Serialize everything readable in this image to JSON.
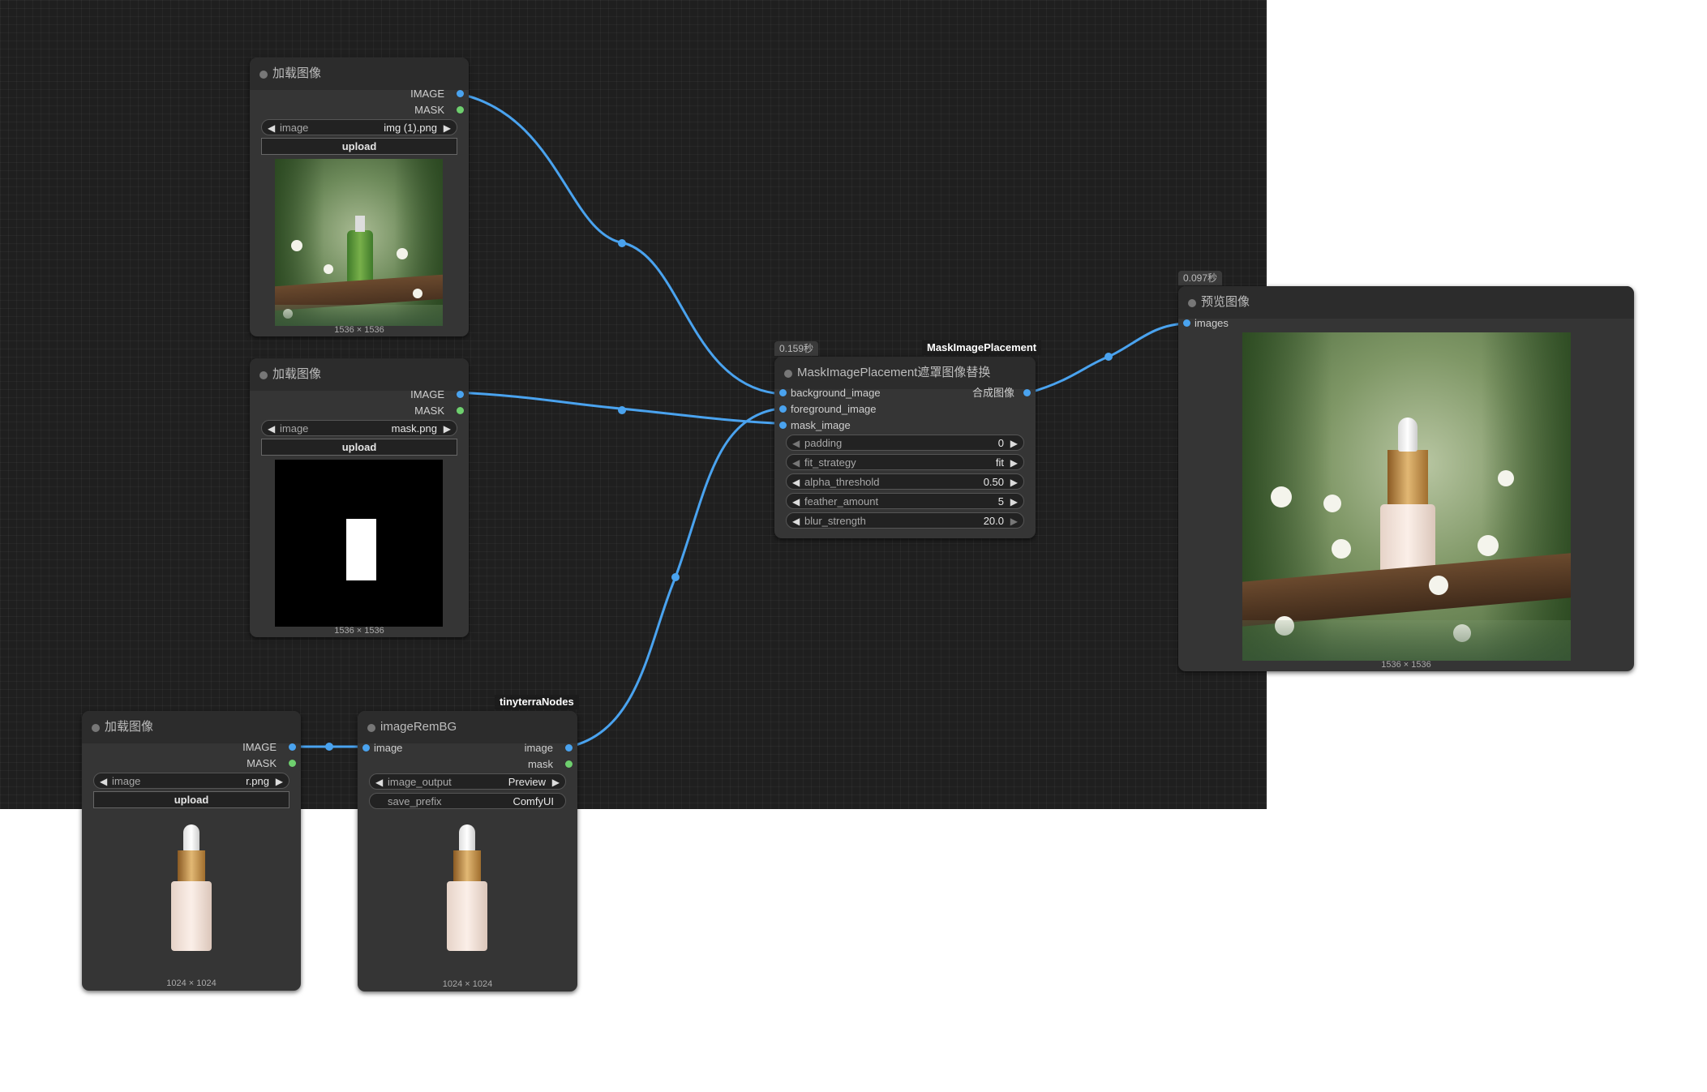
{
  "nodes": {
    "load1": {
      "title": "加载图像",
      "out_image": "IMAGE",
      "out_mask": "MASK",
      "widget_label": "image",
      "widget_value": "img (1).png",
      "upload": "upload",
      "size": "1536 × 1536"
    },
    "load2": {
      "title": "加载图像",
      "out_image": "IMAGE",
      "out_mask": "MASK",
      "widget_label": "image",
      "widget_value": "mask.png",
      "upload": "upload",
      "size": "1536 × 1536"
    },
    "load3": {
      "title": "加载图像",
      "out_image": "IMAGE",
      "out_mask": "MASK",
      "widget_label": "image",
      "widget_value": "r.png",
      "upload": "upload",
      "size": "1024 × 1024"
    },
    "rembg": {
      "tag": "tinyterraNodes",
      "title": "imageRemBG",
      "in_image": "image",
      "out_image": "image",
      "out_mask": "mask",
      "w1_label": "image_output",
      "w1_value": "Preview",
      "w2_label": "save_prefix",
      "w2_value": "ComfyUI",
      "size": "1024 × 1024"
    },
    "mask": {
      "tag": "MaskImagePlacement",
      "time": "0.159秒",
      "title": "MaskImagePlacement遮罩图像替换",
      "in1": "background_image",
      "in2": "foreground_image",
      "in3": "mask_image",
      "out": "合成图像",
      "widgets": [
        {
          "label": "padding",
          "value": "0"
        },
        {
          "label": "fit_strategy",
          "value": "fit"
        },
        {
          "label": "alpha_threshold",
          "value": "0.50"
        },
        {
          "label": "feather_amount",
          "value": "5"
        },
        {
          "label": "blur_strength",
          "value": "20.0"
        }
      ]
    },
    "preview": {
      "time": "0.097秒",
      "title": "预览图像",
      "in": "images",
      "size": "1536 × 1536"
    }
  },
  "colors": {
    "wire": "#4aa3ef",
    "canvas": "#1f1f1f",
    "node": "#353535"
  }
}
